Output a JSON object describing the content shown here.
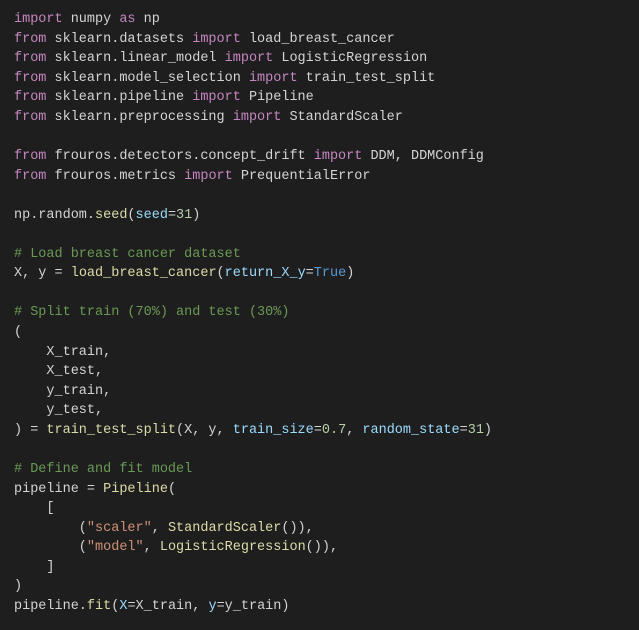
{
  "code": {
    "lines": [
      [
        [
          "kw",
          "import"
        ],
        [
          "pl",
          " numpy "
        ],
        [
          "kw",
          "as"
        ],
        [
          "pl",
          " np"
        ]
      ],
      [
        [
          "kw",
          "from"
        ],
        [
          "pl",
          " sklearn.datasets "
        ],
        [
          "kw",
          "import"
        ],
        [
          "pl",
          " load_breast_cancer"
        ]
      ],
      [
        [
          "kw",
          "from"
        ],
        [
          "pl",
          " sklearn.linear_model "
        ],
        [
          "kw",
          "import"
        ],
        [
          "pl",
          " LogisticRegression"
        ]
      ],
      [
        [
          "kw",
          "from"
        ],
        [
          "pl",
          " sklearn.model_selection "
        ],
        [
          "kw",
          "import"
        ],
        [
          "pl",
          " train_test_split"
        ]
      ],
      [
        [
          "kw",
          "from"
        ],
        [
          "pl",
          " sklearn.pipeline "
        ],
        [
          "kw",
          "import"
        ],
        [
          "pl",
          " Pipeline"
        ]
      ],
      [
        [
          "kw",
          "from"
        ],
        [
          "pl",
          " sklearn.preprocessing "
        ],
        [
          "kw",
          "import"
        ],
        [
          "pl",
          " StandardScaler"
        ]
      ],
      [],
      [
        [
          "kw",
          "from"
        ],
        [
          "pl",
          " frouros.detectors.concept_drift "
        ],
        [
          "kw",
          "import"
        ],
        [
          "pl",
          " DDM, DDMConfig"
        ]
      ],
      [
        [
          "kw",
          "from"
        ],
        [
          "pl",
          " frouros.metrics "
        ],
        [
          "kw",
          "import"
        ],
        [
          "pl",
          " PrequentialError"
        ]
      ],
      [],
      [
        [
          "pl",
          "np.random."
        ],
        [
          "fn",
          "seed"
        ],
        [
          "pl",
          "("
        ],
        [
          "arg",
          "seed"
        ],
        [
          "pl",
          "="
        ],
        [
          "num",
          "31"
        ],
        [
          "pl",
          ")"
        ]
      ],
      [],
      [
        [
          "com",
          "# Load breast cancer dataset"
        ]
      ],
      [
        [
          "pl",
          "X, y = "
        ],
        [
          "fn",
          "load_breast_cancer"
        ],
        [
          "pl",
          "("
        ],
        [
          "arg",
          "return_X_y"
        ],
        [
          "pl",
          "="
        ],
        [
          "bool",
          "True"
        ],
        [
          "pl",
          ")"
        ]
      ],
      [],
      [
        [
          "com",
          "# Split train (70%) and test (30%)"
        ]
      ],
      [
        [
          "pl",
          "("
        ]
      ],
      [
        [
          "pl",
          "    X_train,"
        ]
      ],
      [
        [
          "pl",
          "    X_test,"
        ]
      ],
      [
        [
          "pl",
          "    y_train,"
        ]
      ],
      [
        [
          "pl",
          "    y_test,"
        ]
      ],
      [
        [
          "pl",
          ") = "
        ],
        [
          "fn",
          "train_test_split"
        ],
        [
          "pl",
          "(X, y, "
        ],
        [
          "arg",
          "train_size"
        ],
        [
          "pl",
          "="
        ],
        [
          "num",
          "0.7"
        ],
        [
          "pl",
          ", "
        ],
        [
          "arg",
          "random_state"
        ],
        [
          "pl",
          "="
        ],
        [
          "num",
          "31"
        ],
        [
          "pl",
          ")"
        ]
      ],
      [],
      [
        [
          "com",
          "# Define and fit model"
        ]
      ],
      [
        [
          "pl",
          "pipeline = "
        ],
        [
          "fn",
          "Pipeline"
        ],
        [
          "pl",
          "("
        ]
      ],
      [
        [
          "pl",
          "    ["
        ]
      ],
      [
        [
          "pl",
          "        ("
        ],
        [
          "str",
          "\"scaler\""
        ],
        [
          "pl",
          ", "
        ],
        [
          "fn",
          "StandardScaler"
        ],
        [
          "pl",
          "()),"
        ]
      ],
      [
        [
          "pl",
          "        ("
        ],
        [
          "str",
          "\"model\""
        ],
        [
          "pl",
          ", "
        ],
        [
          "fn",
          "LogisticRegression"
        ],
        [
          "pl",
          "()),"
        ]
      ],
      [
        [
          "pl",
          "    ]"
        ]
      ],
      [
        [
          "pl",
          ")"
        ]
      ],
      [
        [
          "pl",
          "pipeline."
        ],
        [
          "fn",
          "fit"
        ],
        [
          "pl",
          "("
        ],
        [
          "arg",
          "X"
        ],
        [
          "pl",
          "=X_train, "
        ],
        [
          "arg",
          "y"
        ],
        [
          "pl",
          "=y_train)"
        ]
      ]
    ]
  }
}
